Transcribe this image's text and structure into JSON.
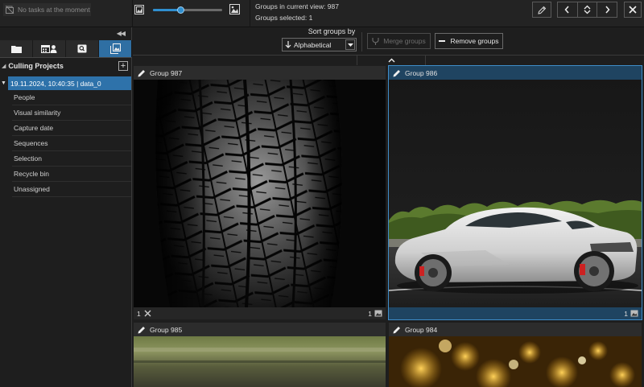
{
  "topbar": {
    "tasks_text": "No tasks at the moment",
    "zoom_percent": 40,
    "groups_in_view": "Groups in current view: 987",
    "groups_selected": "Groups selected: 1"
  },
  "sidebar": {
    "tab_icons": [
      "folder-icon",
      "calendar-people-icon",
      "search-icon",
      "photos-icon"
    ],
    "active_tab": 3,
    "projects_title": "Culling Projects",
    "session": "19.11.2024, 10:40:35 | data_0",
    "items": [
      {
        "label": "People"
      },
      {
        "label": "Visual similarity"
      },
      {
        "label": "Capture date"
      },
      {
        "label": "Sequences"
      },
      {
        "label": "Selection"
      },
      {
        "label": "Recycle bin"
      },
      {
        "label": "Unassigned"
      }
    ],
    "active_item": 1
  },
  "toolbar": {
    "sort_label": "Sort groups by",
    "sort_value": "Alphabetical",
    "merge_label": "Merge groups",
    "remove_label": "Remove groups"
  },
  "groups": [
    {
      "title": "Group 987",
      "count_left": "1",
      "count_right": "1",
      "selected": false
    },
    {
      "title": "Group 986",
      "count_left": "",
      "count_right": "1",
      "selected": true
    },
    {
      "title": "Group 985",
      "selected": false
    },
    {
      "title": "Group 984",
      "selected": false
    }
  ],
  "colors": {
    "accent": "#2e72aa",
    "selection_outline": "#3f8dc9",
    "background": "#1e1e1e"
  }
}
